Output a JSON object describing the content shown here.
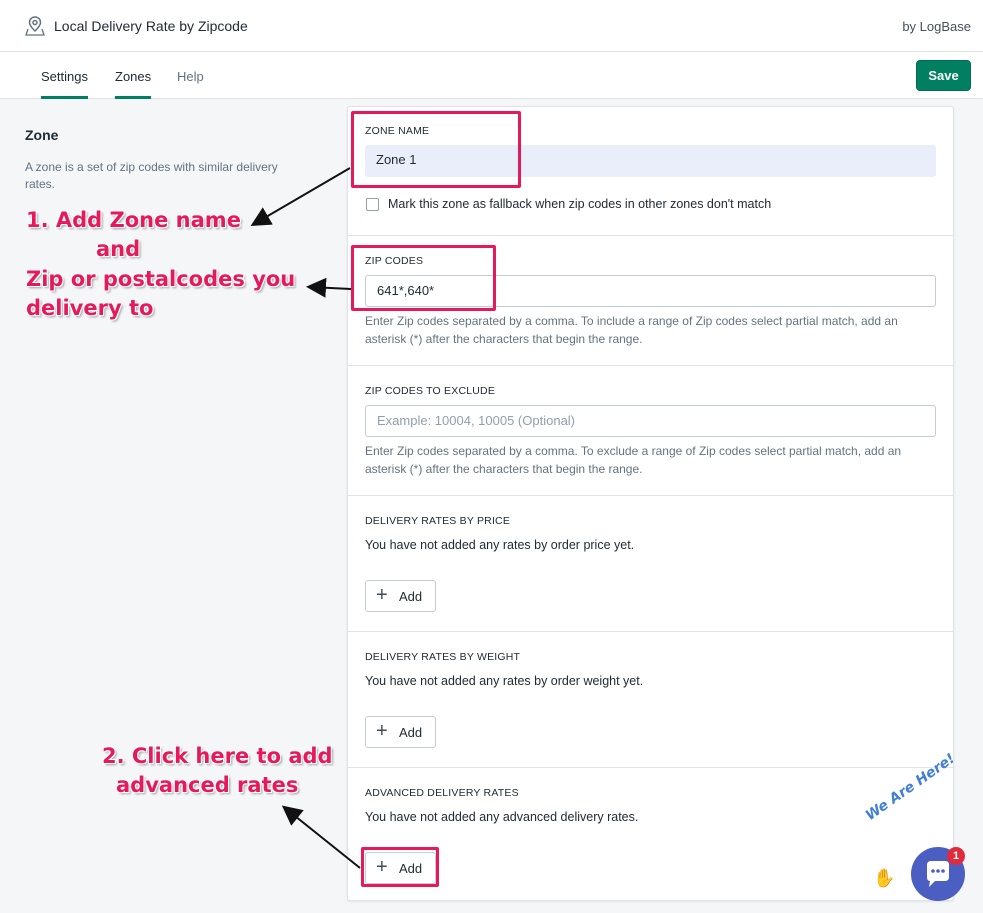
{
  "app": {
    "title": "Local Delivery Rate by Zipcode",
    "by": "by LogBase"
  },
  "tabs": [
    {
      "label": "Settings",
      "active": true
    },
    {
      "label": "Zones",
      "active": true
    },
    {
      "label": "Help",
      "active": false
    }
  ],
  "toolbar": {
    "save_label": "Save"
  },
  "sidebar": {
    "title": "Zone",
    "description": "A zone is a set of zip codes with similar delivery rates."
  },
  "zone_name": {
    "label": "ZONE NAME",
    "value": "Zone 1",
    "fallback_label": "Mark this zone as fallback when zip codes in other zones don't match"
  },
  "zip_codes": {
    "label": "ZIP CODES",
    "value": "641*,640*",
    "help": "Enter Zip codes separated by a comma. To include a range of Zip codes select partial match, add an asterisk (*) after the characters that begin the range."
  },
  "zip_exclude": {
    "label": "ZIP CODES TO EXCLUDE",
    "placeholder": "Example: 10004, 10005 (Optional)",
    "help": "Enter Zip codes separated by a comma. To exclude a range of Zip codes select partial match, add an asterisk (*) after the characters that begin the range."
  },
  "rates_price": {
    "label": "DELIVERY RATES BY PRICE",
    "empty": "You have not added any rates by order price yet.",
    "add_label": "Add"
  },
  "rates_weight": {
    "label": "DELIVERY RATES BY WEIGHT",
    "empty": "You have not added any rates by order weight yet.",
    "add_label": "Add"
  },
  "rates_advanced": {
    "label": "ADVANCED DELIVERY RATES",
    "empty": "You have not added any advanced delivery rates.",
    "add_label": "Add"
  },
  "annotations": {
    "step1_line1": "1. Add Zone name",
    "step1_line2": "and",
    "step1_line3": "Zip or postalcodes you",
    "step1_line4": "delivery to",
    "step2_line1": "2. Click here to add",
    "step2_line2": "advanced rates"
  },
  "chat": {
    "badge": "1",
    "greeting": "We Are Here!"
  },
  "colors": {
    "accent": "#008060",
    "highlight": "#e6195a",
    "chat": "#4b5fc3"
  }
}
